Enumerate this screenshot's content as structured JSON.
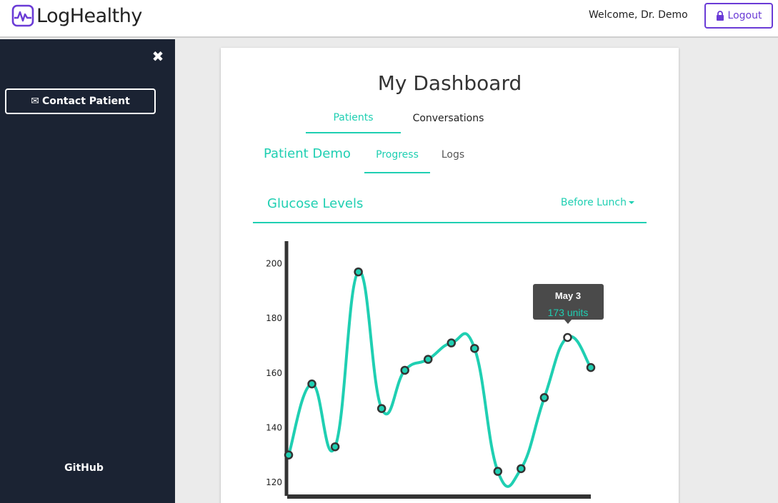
{
  "header": {
    "app_name": "LogHealthy",
    "welcome": "Welcome, Dr. Demo",
    "logout_label": "Logout"
  },
  "sidebar": {
    "close_icon": "close-icon",
    "contact_label": "Contact Patient",
    "github_label": "GitHub"
  },
  "main": {
    "title": "My Dashboard",
    "tabs": [
      {
        "label": "Patients",
        "active": true
      },
      {
        "label": "Conversations",
        "active": false
      }
    ],
    "patient_name": "Patient Demo",
    "subtabs": [
      {
        "label": "Progress",
        "active": true
      },
      {
        "label": "Logs",
        "active": false
      }
    ],
    "section_title": "Glucose Levels",
    "filter_selected": "Before Lunch"
  },
  "colors": {
    "accent": "#1fcfb2",
    "brand": "#6a3bd6",
    "sidebar": "#1b2333"
  },
  "chart_data": {
    "type": "line",
    "title": "",
    "xlabel": "",
    "ylabel": "",
    "y": [
      130,
      156,
      133,
      197,
      147,
      161,
      165,
      171,
      169,
      124,
      125,
      151,
      173,
      162
    ],
    "yticks": [
      120,
      140,
      160,
      180,
      200
    ],
    "ylim": [
      117,
      210
    ],
    "tooltip": {
      "date": "May 3",
      "value": "173 units",
      "index": 12
    },
    "grid": false
  }
}
